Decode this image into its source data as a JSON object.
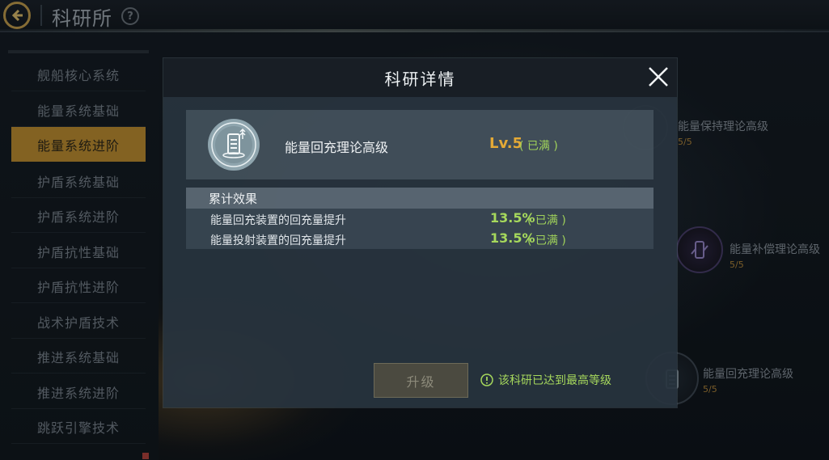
{
  "header": {
    "title": "科研所",
    "back_icon": "back-arrow-icon",
    "help_icon": "help-icon",
    "help_glyph": "?"
  },
  "sidebar": {
    "items": [
      {
        "label": "舰船核心系统",
        "active": false
      },
      {
        "label": "能量系统基础",
        "active": false
      },
      {
        "label": "能量系统进阶",
        "active": true
      },
      {
        "label": "护盾系统基础",
        "active": false
      },
      {
        "label": "护盾系统进阶",
        "active": false
      },
      {
        "label": "护盾抗性基础",
        "active": false
      },
      {
        "label": "护盾抗性进阶",
        "active": false
      },
      {
        "label": "战术护盾技术",
        "active": false
      },
      {
        "label": "推进系统基础",
        "active": false
      },
      {
        "label": "推进系统进阶",
        "active": false
      },
      {
        "label": "跳跃引擎技术",
        "active": false
      }
    ]
  },
  "tree_nodes": [
    {
      "label": "能量保持理论高级",
      "level": "5/5"
    },
    {
      "label": "能量补偿理论高级",
      "level": "5/5"
    },
    {
      "label": "能量回充理论高级",
      "level": "5/5"
    }
  ],
  "dialog": {
    "title": "科研详情",
    "close_icon": "close-icon",
    "tech": {
      "name": "能量回充理论高级",
      "level": "Lv.5",
      "status": "( 已满 )",
      "icon": "energy-recharge-tech-icon"
    },
    "effects": {
      "title": "累计效果",
      "rows": [
        {
          "name": "能量回充装置的回充量提升",
          "value": "13.5%",
          "status": "( 已满 )"
        },
        {
          "name": "能量投射装置的回充量提升",
          "value": "13.5%",
          "status": "( 已满 )"
        }
      ]
    },
    "upgrade_label": "升级",
    "max_note": "该科研已达到最高等级",
    "max_note_icon": "info-icon"
  },
  "colors": {
    "accent_gold": "#c7922d",
    "level_orange": "#e4a936",
    "status_green": "#9fd15a"
  }
}
